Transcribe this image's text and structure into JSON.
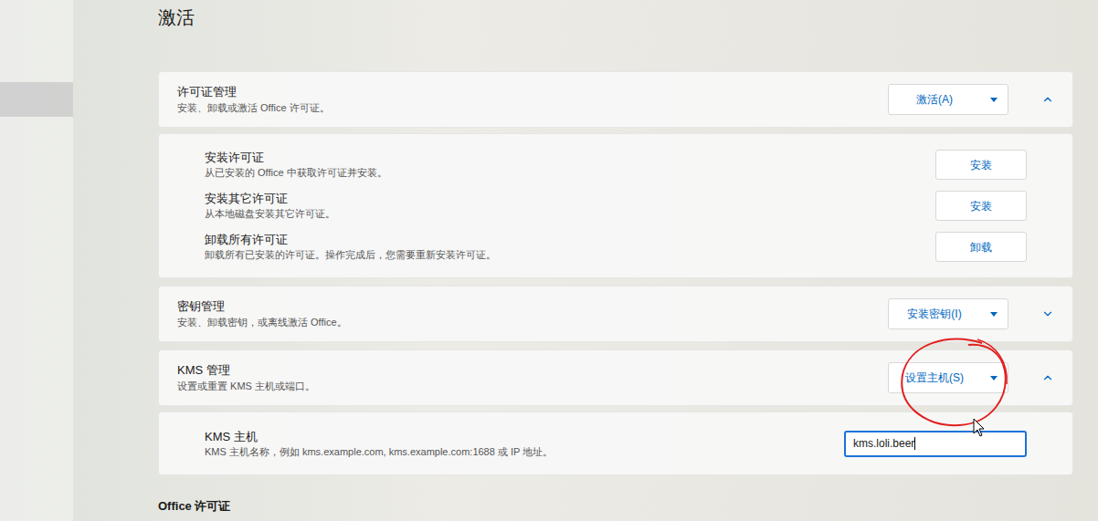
{
  "page": {
    "title": "激活"
  },
  "sidebar": {
    "items": [
      {
        "selected": false
      },
      {
        "selected": true
      }
    ]
  },
  "sections": [
    {
      "title": "许可证管理",
      "description": "安装、卸载或激活 Office 许可证。",
      "button": "激活(A)",
      "expanded": true,
      "rows": [
        {
          "title": "安装许可证",
          "description": "从已安装的 Office 中获取许可证并安装。",
          "button": "安装"
        },
        {
          "title": "安装其它许可证",
          "description": "从本地磁盘安装其它许可证。",
          "button": "安装"
        },
        {
          "title": "卸载所有许可证",
          "description": "卸载所有已安装的许可证。操作完成后，您需要重新安装许可证。",
          "button": "卸载"
        }
      ],
      "fields": []
    },
    {
      "title": "密钥管理",
      "description": "安装、卸载密钥，或离线激活 Office。",
      "button": "安装密钥(I)",
      "expanded": false,
      "rows": [],
      "fields": []
    },
    {
      "title": "KMS 管理",
      "description": "设置或重置 KMS 主机或端口。",
      "button": "设置主机(S)",
      "expanded": true,
      "rows": [],
      "fields": [
        {
          "label": "KMS 主机",
          "description": "KMS 主机名称，例如 kms.example.com, kms.example.com:1688 或 IP 地址。",
          "value": "kms.loli.beer",
          "focused": true
        }
      ]
    }
  ],
  "next_heading": "Office 许可证"
}
